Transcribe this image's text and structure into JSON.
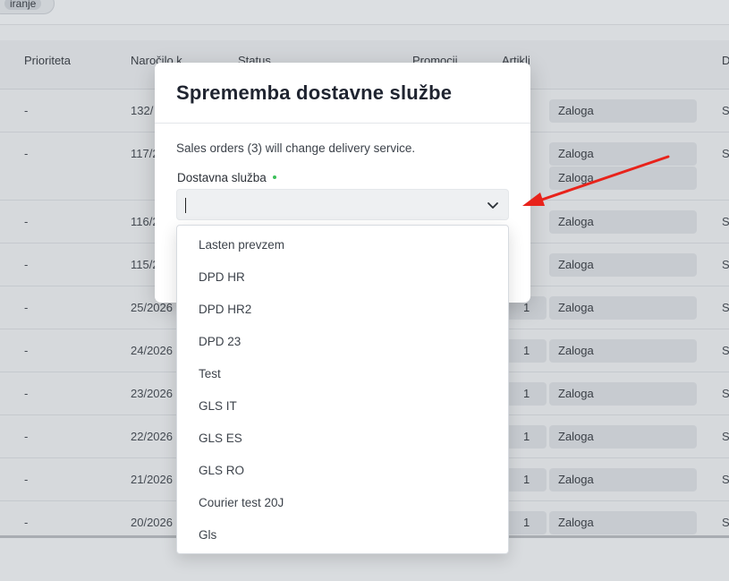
{
  "topbar": {
    "chip_label": "iranje"
  },
  "table": {
    "headers": [
      "Prioriteta",
      "Naročilo k",
      "Status",
      "Promocij",
      "Artikli",
      "D"
    ],
    "rows": [
      {
        "priority": "-",
        "order": "132/",
        "articles": "",
        "stock": [
          "Zaloga"
        ],
        "last": "S"
      },
      {
        "priority": "-",
        "order": "117/2",
        "articles": "",
        "stock": [
          "Zaloga",
          "Zaloga"
        ],
        "last": "S"
      },
      {
        "priority": "-",
        "order": "116/2",
        "articles": "",
        "stock": [
          "Zaloga"
        ],
        "last": "S"
      },
      {
        "priority": "-",
        "order": "115/2",
        "articles": "",
        "stock": [
          "Zaloga"
        ],
        "last": "S"
      },
      {
        "priority": "-",
        "order": "25/2026",
        "articles": "1",
        "stock": [
          "Zaloga"
        ],
        "last": "S"
      },
      {
        "priority": "-",
        "order": "24/2026",
        "articles": "1",
        "stock": [
          "Zaloga"
        ],
        "last": "S"
      },
      {
        "priority": "-",
        "order": "23/2026",
        "articles": "1",
        "stock": [
          "Zaloga"
        ],
        "last": "S"
      },
      {
        "priority": "-",
        "order": "22/2026",
        "articles": "1",
        "stock": [
          "Zaloga"
        ],
        "last": "S"
      },
      {
        "priority": "-",
        "order": "21/2026",
        "articles": "1",
        "stock": [
          "Zaloga"
        ],
        "last": "S"
      },
      {
        "priority": "-",
        "order": "20/2026",
        "articles": "1",
        "stock": [
          "Zaloga"
        ],
        "last": "S"
      }
    ]
  },
  "modal": {
    "title": "Sprememba dostavne službe",
    "description": "Sales orders (3) will change delivery service.",
    "field_label": "Dostavna služba",
    "select_value": "",
    "required_color": "#3cbf5a"
  },
  "dropdown": {
    "options": [
      "Lasten prevzem",
      "DPD HR",
      "DPD HR2",
      "DPD 23",
      "Test",
      "GLS IT",
      "GLS ES",
      "GLS RO",
      "Courier test 20J",
      "Gls"
    ]
  },
  "annotation": {
    "arrow_color": "#e8231b"
  },
  "icons": {
    "select_chevron": "chevron-down-icon"
  }
}
